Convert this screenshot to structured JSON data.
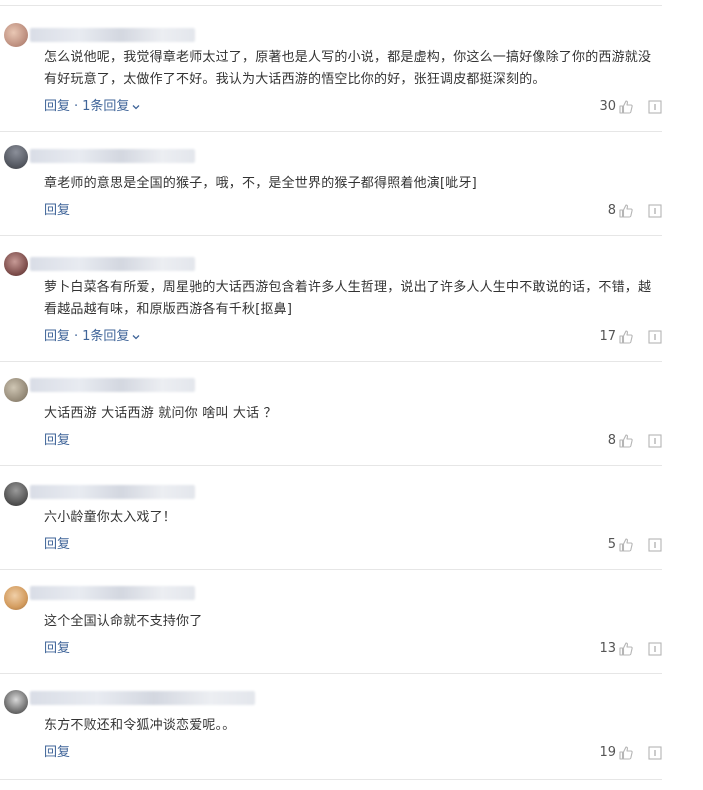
{
  "labels": {
    "reply": "回复",
    "separator": "·"
  },
  "comments": [
    {
      "text": "怎么说他呢，我觉得章老师太过了，原著也是人写的小说，都是虚构，你这么一搞好像除了你的西游就没有好玩意了，太做作了不好。我认为大话西游的悟空比你的好，张狂调皮都挺深刻的。",
      "replies_label": "1条回复",
      "likes": "30"
    },
    {
      "text": "章老师的意思是全国的猴子，哦，不，是全世界的猴子都得照着他演[呲牙]",
      "replies_label": "",
      "likes": "8"
    },
    {
      "text": "萝卜白菜各有所爱，周星驰的大话西游包含着许多人生哲理，说出了许多人人生中不敢说的话，不错，越看越品越有味，和原版西游各有千秋[抠鼻]",
      "replies_label": "1条回复",
      "likes": "17"
    },
    {
      "text": "大话西游 大话西游 就问你 啥叫 大话 ？",
      "replies_label": "",
      "likes": "8"
    },
    {
      "text": "六小龄童你太入戏了！",
      "replies_label": "",
      "likes": "5"
    },
    {
      "text": "这个全国认命就不支持你了",
      "replies_label": "",
      "likes": "13"
    },
    {
      "text": "东方不败还和令狐冲谈恋爱呢。。",
      "replies_label": "",
      "likes": "19"
    }
  ]
}
